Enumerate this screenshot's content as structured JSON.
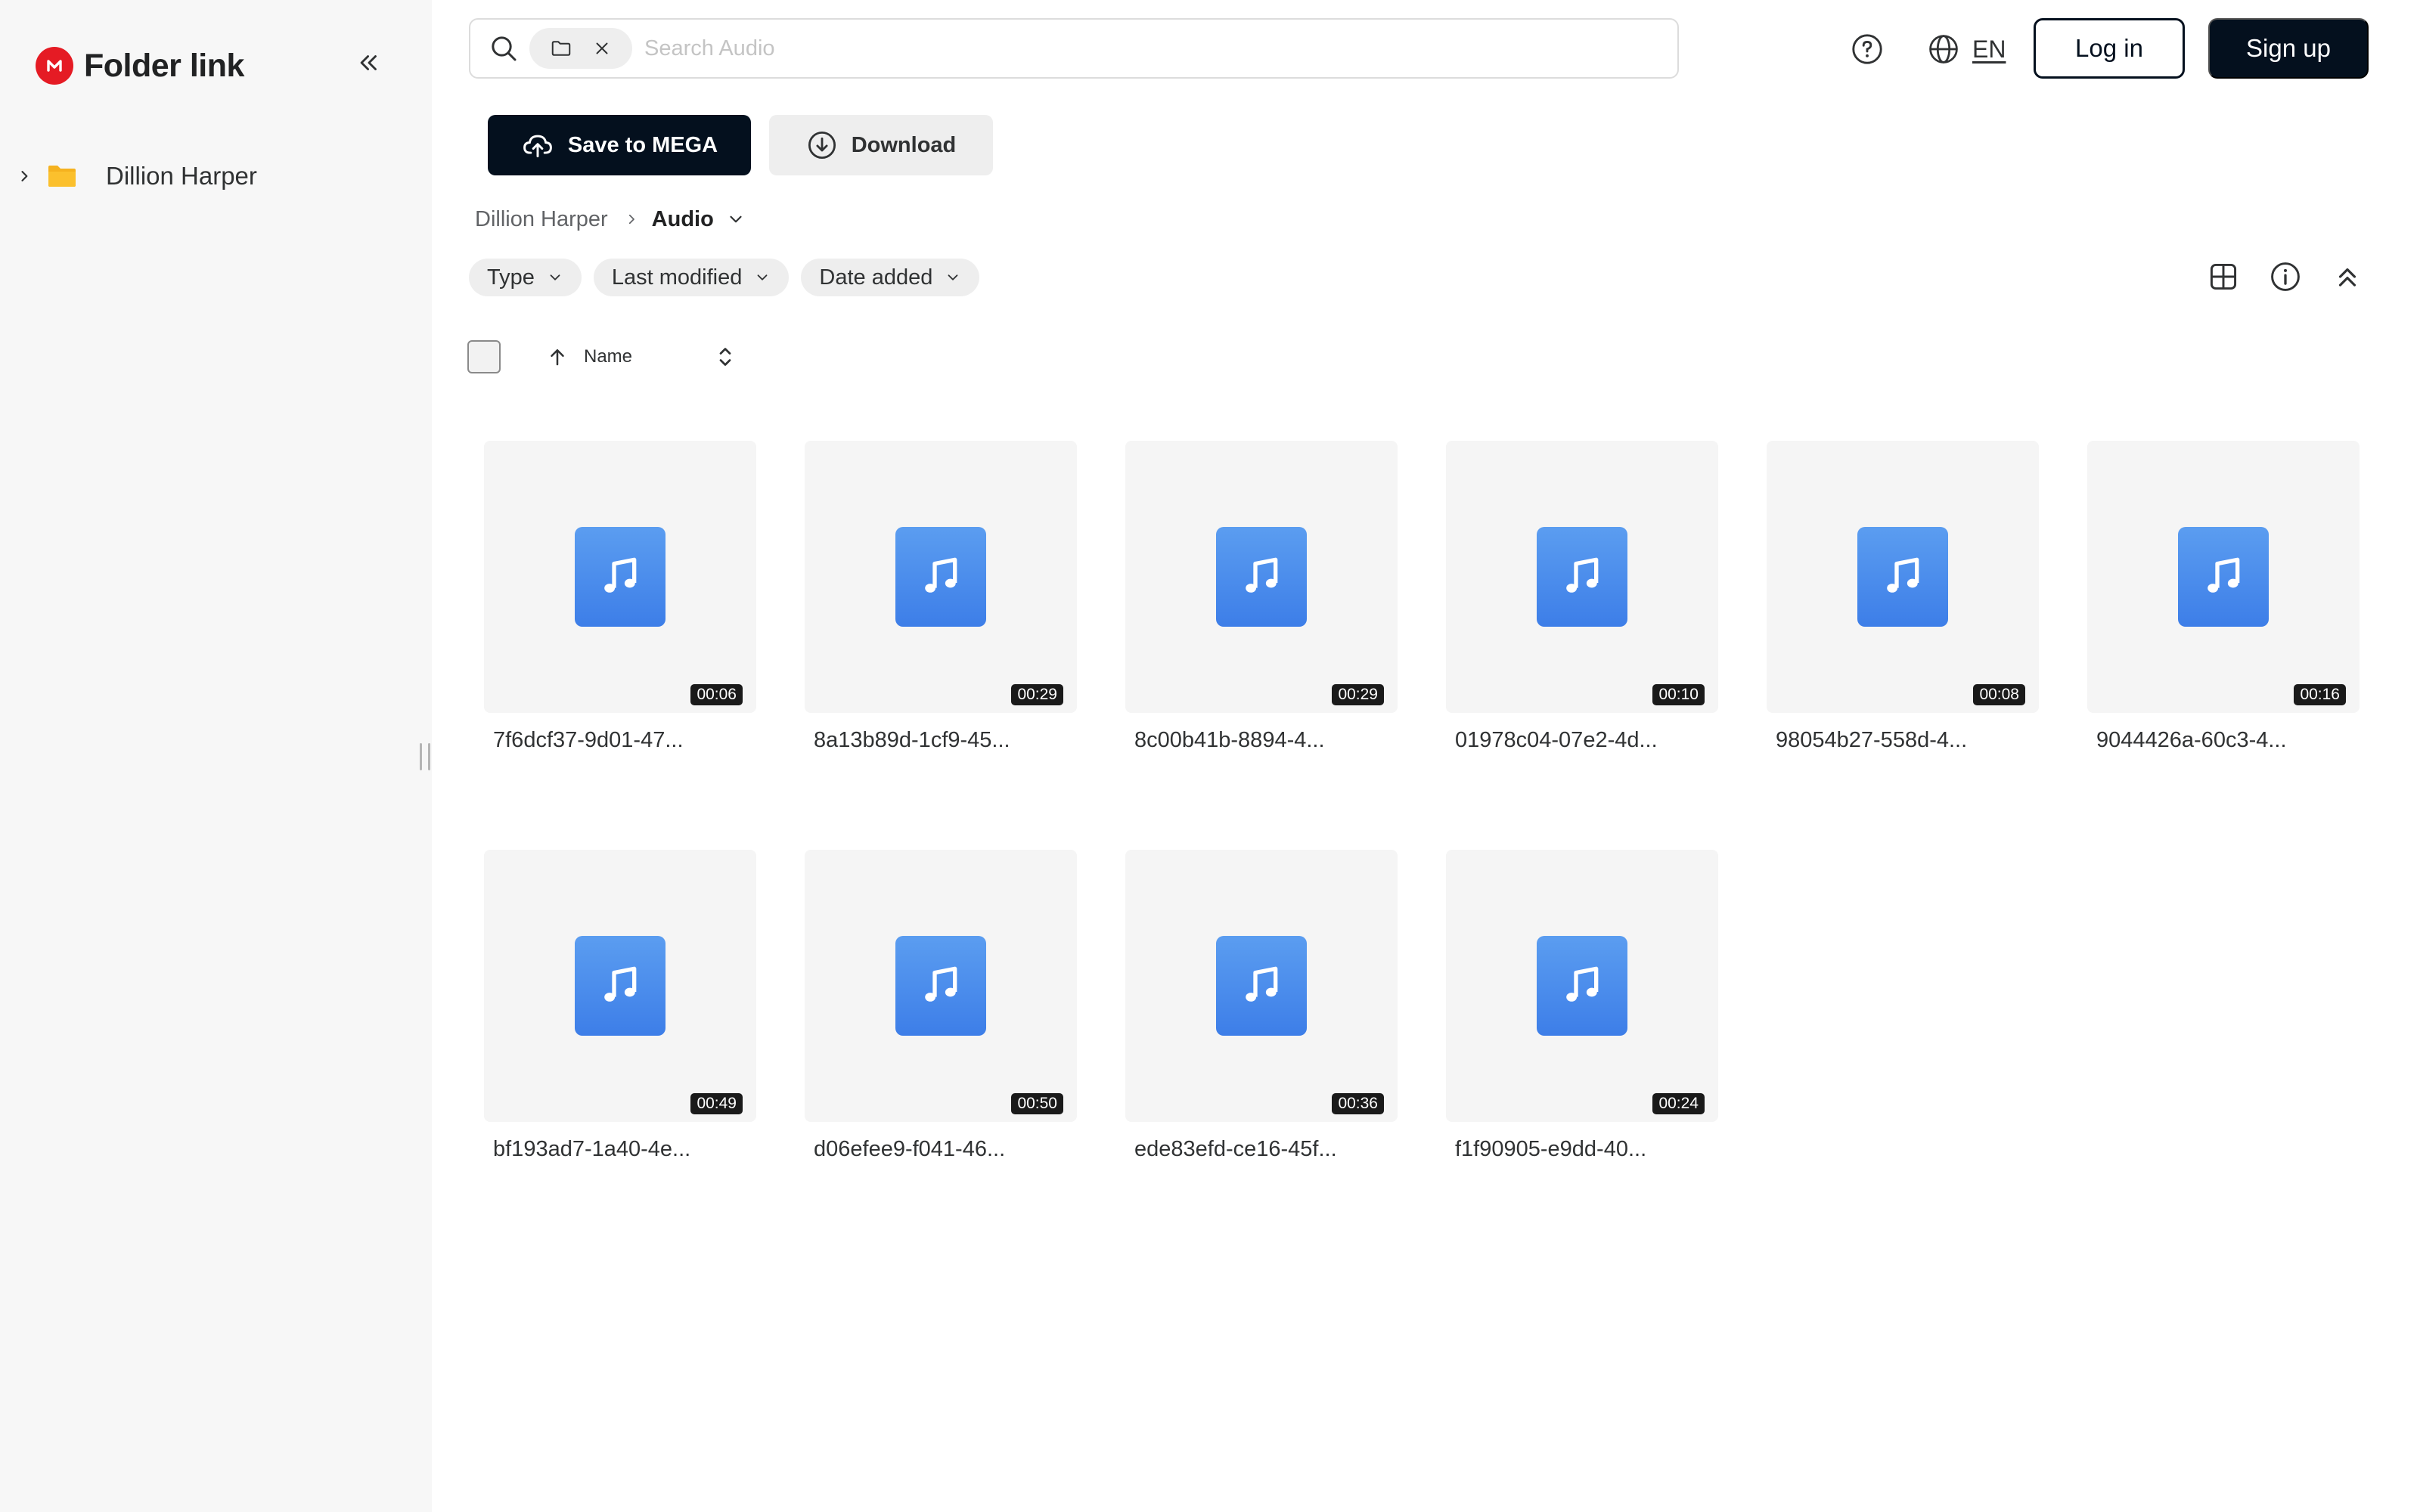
{
  "sidebar": {
    "title": "Folder link",
    "tree": [
      {
        "label": "Dillion Harper"
      }
    ]
  },
  "search": {
    "placeholder": "Search Audio",
    "value": ""
  },
  "header": {
    "language": "EN",
    "login_label": "Log in",
    "signup_label": "Sign up"
  },
  "actions": {
    "save_label": "Save to MEGA",
    "download_label": "Download"
  },
  "breadcrumb": {
    "root": "Dillion Harper",
    "current": "Audio"
  },
  "filters": [
    {
      "label": "Type"
    },
    {
      "label": "Last modified"
    },
    {
      "label": "Date added"
    }
  ],
  "sort": {
    "label": "Name",
    "direction": "ascending"
  },
  "files": [
    {
      "name": "7f6dcf37-9d01-47...",
      "duration": "00:06"
    },
    {
      "name": "8a13b89d-1cf9-45...",
      "duration": "00:29"
    },
    {
      "name": "8c00b41b-8894-4...",
      "duration": "00:29"
    },
    {
      "name": "01978c04-07e2-4d...",
      "duration": "00:10"
    },
    {
      "name": "98054b27-558d-4...",
      "duration": "00:08"
    },
    {
      "name": "9044426a-60c3-4...",
      "duration": "00:16"
    },
    {
      "name": "bf193ad7-1a40-4e...",
      "duration": "00:49"
    },
    {
      "name": "d06efee9-f041-46...",
      "duration": "00:50"
    },
    {
      "name": "ede83efd-ce16-45f...",
      "duration": "00:36"
    },
    {
      "name": "f1f90905-e9dd-40...",
      "duration": "00:24"
    }
  ],
  "colors": {
    "brand": "#e51b24",
    "primary_dark": "#04101e",
    "audio_icon": "#4a8bef",
    "folder": "#f5b21f"
  },
  "icons": {
    "brand": "mega-logo-icon",
    "collapse": "double-chevron-left-icon",
    "search": "search-icon",
    "help": "help-circle-icon",
    "language": "globe-icon",
    "save": "cloud-upload-icon",
    "download": "download-circle-icon",
    "grid_view": "grid-view-icon",
    "info": "info-icon",
    "collapse_header": "double-chevron-up-icon",
    "file": "music-note-icon"
  }
}
